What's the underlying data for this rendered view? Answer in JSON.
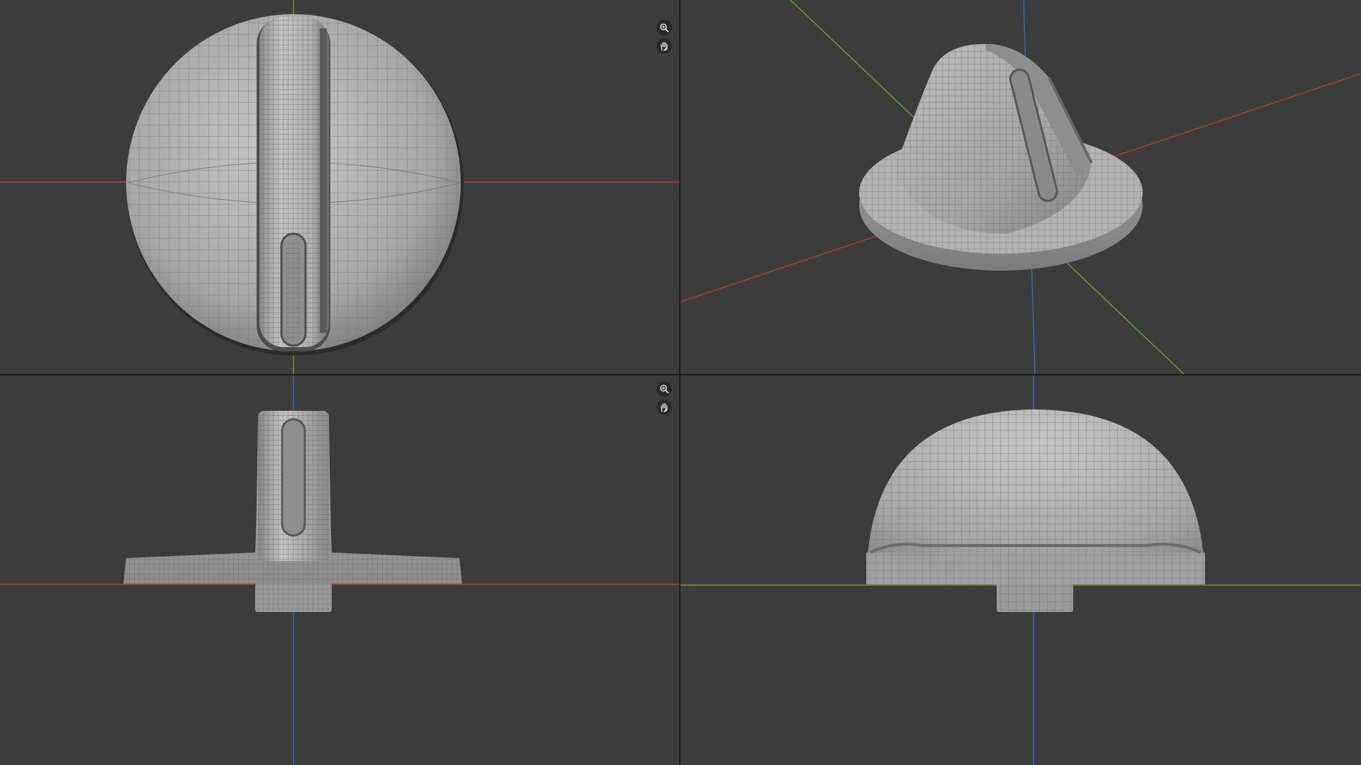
{
  "viewports": [
    {
      "id": "top-view",
      "tools": [
        "zoom-icon",
        "pan-hand-icon"
      ]
    },
    {
      "id": "perspective-view",
      "tools": []
    },
    {
      "id": "front-view",
      "tools": [
        "zoom-icon",
        "pan-hand-icon"
      ]
    },
    {
      "id": "side-view",
      "tools": []
    }
  ],
  "colors": {
    "background": "#3c3c3c",
    "divider": "#1e1e1e",
    "x_axis": "#b03a3a",
    "y_axis": "#6a9a3a",
    "z_axis": "#3a6ab0",
    "mesh_fill": "#a8a8a8",
    "mesh_wire": "#6e6e6e"
  }
}
